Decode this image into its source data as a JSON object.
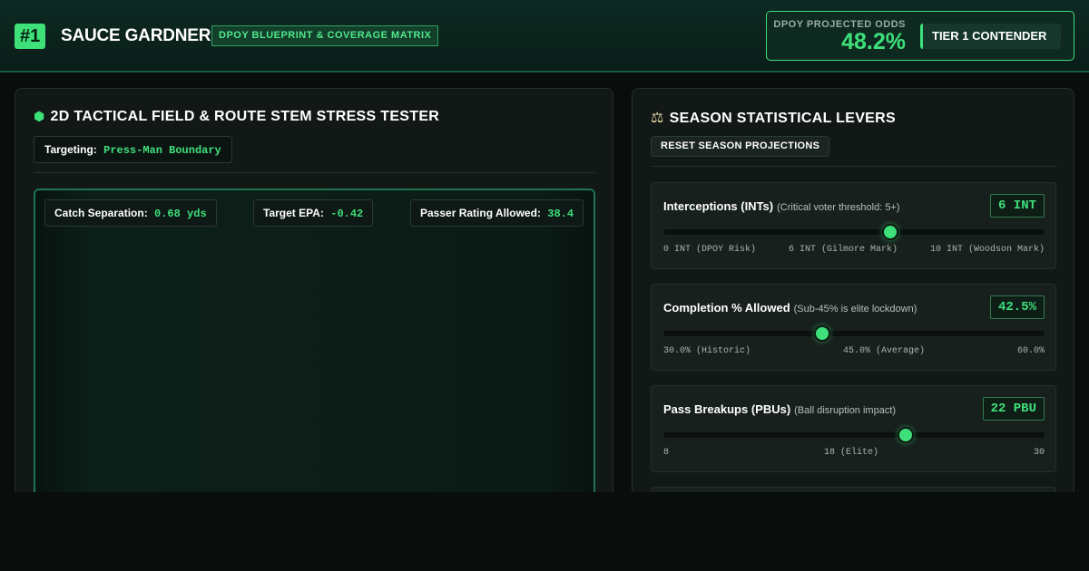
{
  "header": {
    "rank": "#1",
    "player_name": "SAUCE GARDNER",
    "subtitle": "DPOY BLUEPRINT & COVERAGE MATRIX",
    "odds_label": "DPOY PROJECTED ODDS",
    "odds_value": "48.2%",
    "tier": "TIER 1 CONTENDER"
  },
  "field_panel": {
    "icon": "hexagon-icon",
    "title": "2D TACTICAL FIELD & ROUTE STEM STRESS TESTER",
    "targeting_label": "Targeting:",
    "targeting_value": "Press-Man Boundary",
    "stats": [
      {
        "label": "Catch Separation:",
        "value": "0.68 yds"
      },
      {
        "label": "Target EPA:",
        "value": "-0.42"
      },
      {
        "label": "Passer Rating Allowed:",
        "value": "38.4"
      }
    ]
  },
  "levers_panel": {
    "icon": "scale-icon",
    "title": "SEASON STATISTICAL LEVERS",
    "reset_label": "RESET SEASON PROJECTIONS",
    "levers": [
      {
        "name": "Interceptions (INTs)",
        "note": "(Critical voter threshold: 5+)",
        "value": "6 INT",
        "position_fraction": 0.595,
        "ticks": [
          "0 INT (DPOY Risk)",
          "6 INT (Gilmore Mark)",
          "10 INT (Woodson Mark)"
        ]
      },
      {
        "name": "Completion % Allowed",
        "note": "(Sub-45% is elite lockdown)",
        "value": "42.5%",
        "position_fraction": 0.4167,
        "ticks": [
          "30.0% (Historic)",
          "45.0% (Average)",
          "60.0%"
        ]
      },
      {
        "name": "Pass Breakups (PBUs)",
        "note": "(Ball disruption impact)",
        "value": "22 PBU",
        "position_fraction": 0.6364,
        "ticks": [
          "8",
          "18 (Elite)",
          "30"
        ]
      }
    ]
  },
  "colors": {
    "accent": "#3ee07a",
    "background": "#090d0c",
    "panel": "#121816"
  }
}
